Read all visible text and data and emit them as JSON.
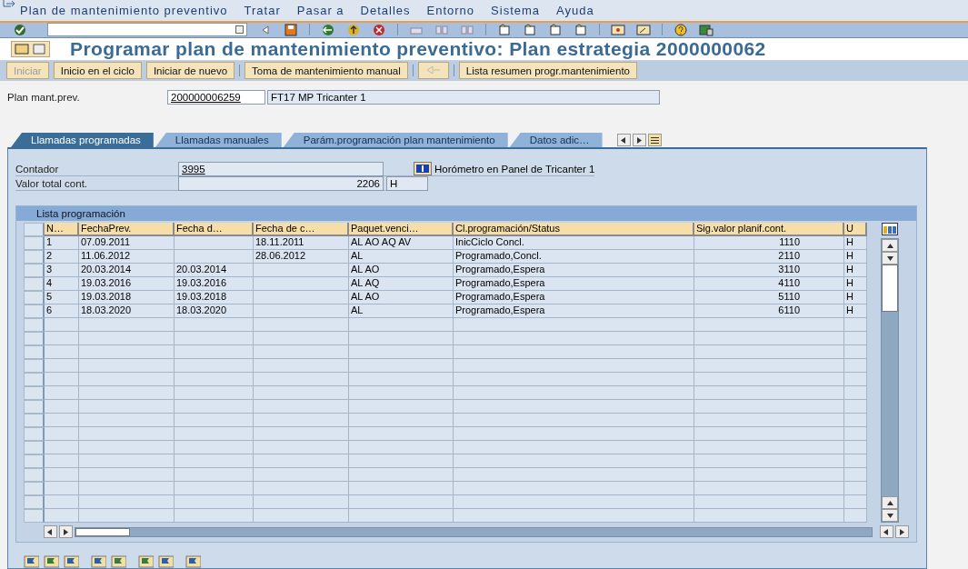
{
  "menu_bar": [
    {
      "label": "Plan de mantenimiento preventivo"
    },
    {
      "label": "Tratar"
    },
    {
      "label": "Pasar a"
    },
    {
      "label": "Detalles"
    },
    {
      "label": "Entorno"
    },
    {
      "label": "Sistema"
    },
    {
      "label": "Ayuda"
    }
  ],
  "title": "Programar plan de mantenimiento preventivo: Plan estrategia 2000000062",
  "app_toolbar": [
    {
      "label": "Iniciar",
      "disabled": true
    },
    {
      "label": "Inicio en el ciclo",
      "disabled": false
    },
    {
      "label": "Iniciar de nuevo",
      "disabled": false
    },
    {
      "label": "Toma de mantenimiento manual",
      "disabled": false
    },
    {
      "label": "Lista resumen progr.mantenimiento",
      "disabled": false
    }
  ],
  "plan": {
    "label": "Plan mant.prev.",
    "value": "200000006259",
    "description": "FT17 MP Tricanter 1"
  },
  "tabs": [
    {
      "label": "Llamadas programadas",
      "selected": true
    },
    {
      "label": "Llamadas manuales",
      "selected": false
    },
    {
      "label": "Parám.programación plan mantenimiento",
      "selected": false
    },
    {
      "label": "Datos adic…",
      "selected": false
    }
  ],
  "counter": {
    "label": "Contador",
    "value": "3995",
    "description": "Horómetro en Panel de Tricanter 1"
  },
  "total": {
    "label": "Valor total cont.",
    "value": "2206",
    "unit": "H"
  },
  "table": {
    "title": "Lista programación",
    "columns": [
      "N…",
      "FechaPrev.",
      "Fecha d…",
      "Fecha de c…",
      "Paquet.venci…",
      "Cl.programación/Status",
      "Sig.valor planif.cont.",
      "U"
    ],
    "rows": [
      [
        "1",
        "07.09.2011",
        "",
        "18.11.2011",
        "AL AO AQ AV",
        "InicCiclo  Concl.",
        "1110",
        "H"
      ],
      [
        "2",
        "11.06.2012",
        "",
        "28.06.2012",
        "AL",
        "Programado,Concl.",
        "2110",
        "H"
      ],
      [
        "3",
        "20.03.2014",
        "20.03.2014",
        "",
        "AL AO",
        "Programado,Espera",
        "3110",
        "H"
      ],
      [
        "4",
        "19.03.2016",
        "19.03.2016",
        "",
        "AL AQ",
        "Programado,Espera",
        "4110",
        "H"
      ],
      [
        "5",
        "19.03.2018",
        "19.03.2018",
        "",
        "AL AO",
        "Programado,Espera",
        "5110",
        "H"
      ],
      [
        "6",
        "18.03.2020",
        "18.03.2020",
        "",
        "AL",
        "Programado,Espera",
        "6110",
        "H"
      ]
    ]
  }
}
